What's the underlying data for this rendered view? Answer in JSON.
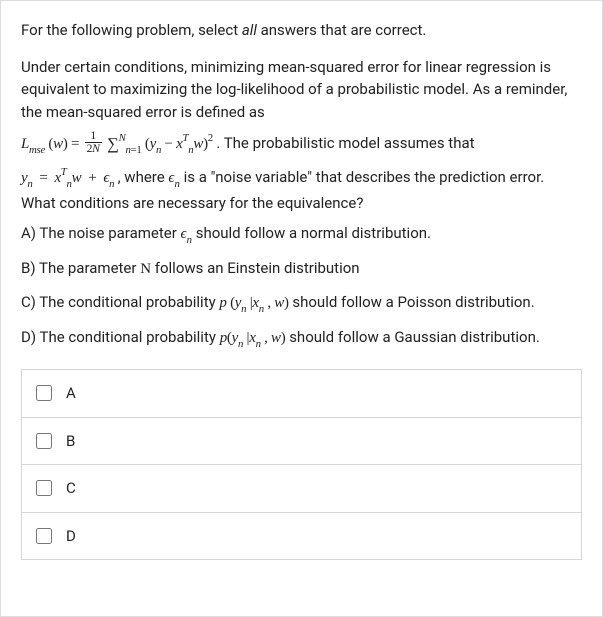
{
  "intro": "For the following problem, select all answers that are correct.",
  "question": {
    "p1": "Under certain conditions, minimizing mean-squared error for linear regression is equivalent to maximizing the log-likelihood of a probabilistic model. As a reminder, the mean-squared error is defined as",
    "eq1_tail": ". The probabilistic model assumes that",
    "eq2_mid": ", where ",
    "eq2_tail": " is a \"noise variable\" that describes the prediction error. What conditions are necessary for the equivalence?"
  },
  "options": {
    "A": {
      "pre": "A) The noise parameter ",
      "post": " should follow a normal distribution."
    },
    "B": {
      "pre": "B) The parameter ",
      "sym": "N",
      "post": " follows an Einstein distribution"
    },
    "C": {
      "pre": "C) The conditional probability ",
      "post": " should follow a Poisson distribution."
    },
    "D": {
      "pre": "D) The conditional probability ",
      "post": " should follow a Gaussian distribution."
    }
  },
  "answers": [
    {
      "key": "A",
      "label": "A"
    },
    {
      "key": "B",
      "label": "B"
    },
    {
      "key": "C",
      "label": "C"
    },
    {
      "key": "D",
      "label": "D"
    }
  ]
}
